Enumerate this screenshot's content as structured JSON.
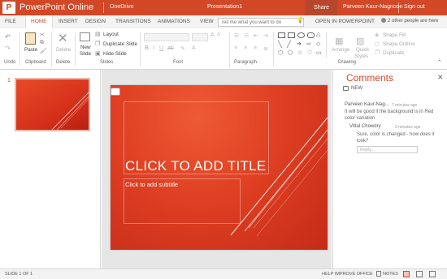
{
  "titlebar": {
    "logo_letter": "P",
    "app_name": "PowerPoint Online",
    "location": "OneDrive",
    "document_name": "Presentation1",
    "share_label": "Share",
    "user_name": "Parveen Kaur-Nagnoon",
    "sign_out_label": "Sign out",
    "brand_color": "#d24726"
  },
  "tabs": [
    {
      "label": "FILE"
    },
    {
      "label": "HOME"
    },
    {
      "label": "INSERT"
    },
    {
      "label": "DESIGN"
    },
    {
      "label": "TRANSITIONS"
    },
    {
      "label": "ANIMATIONS"
    },
    {
      "label": "VIEW"
    }
  ],
  "tell_me": {
    "placeholder": "Tell me what you want to do"
  },
  "open_in_label": "OPEN IN POWERPOINT",
  "others_label": "2 other people are here",
  "ribbon": {
    "groups": {
      "undo": "Undo",
      "clipboard": "Clipboard",
      "delete": "Delete",
      "slides": "Slides",
      "font": "Font",
      "paragraph": "Paragraph",
      "drawing": "Drawing"
    },
    "paste_label": "Paste",
    "delete_label": "Delete",
    "new_slide_line1": "New",
    "new_slide_line2": "Slide",
    "layout_label": "Layout",
    "duplicate_slide_label": "Duplicate Slide",
    "hide_slide_label": "Hide Slide",
    "arrange_label": "Arrange",
    "quick_styles_line1": "Quick",
    "quick_styles_line2": "Styles",
    "shape_fill_label": "Shape Fill",
    "shape_outline_label": "Shape Outline",
    "duplicate_label": "Duplicate"
  },
  "thumbnails": [
    {
      "number": "1"
    }
  ],
  "slide": {
    "title_placeholder": "CLICK TO ADD TITLE",
    "subtitle_placeholder": "Click to add subtitle"
  },
  "comments": {
    "title": "Comments",
    "close_glyph": "✕",
    "new_label": "NEW",
    "items": [
      {
        "author": "Parveen Kaur-Nag...",
        "time": "7 minutes ago",
        "text": "It will be good if the background is in Red color variation"
      },
      {
        "author": "Vittal Chowdry",
        "time": "3 minutes ago",
        "text": "Sure, color is changed - how does it look?"
      }
    ],
    "reply_placeholder": "Reply..."
  },
  "statusbar": {
    "slide_count": "SLIDE 1 OF 1",
    "help_improve": "HELP IMPROVE OFFICE",
    "notes": "NOTES"
  }
}
